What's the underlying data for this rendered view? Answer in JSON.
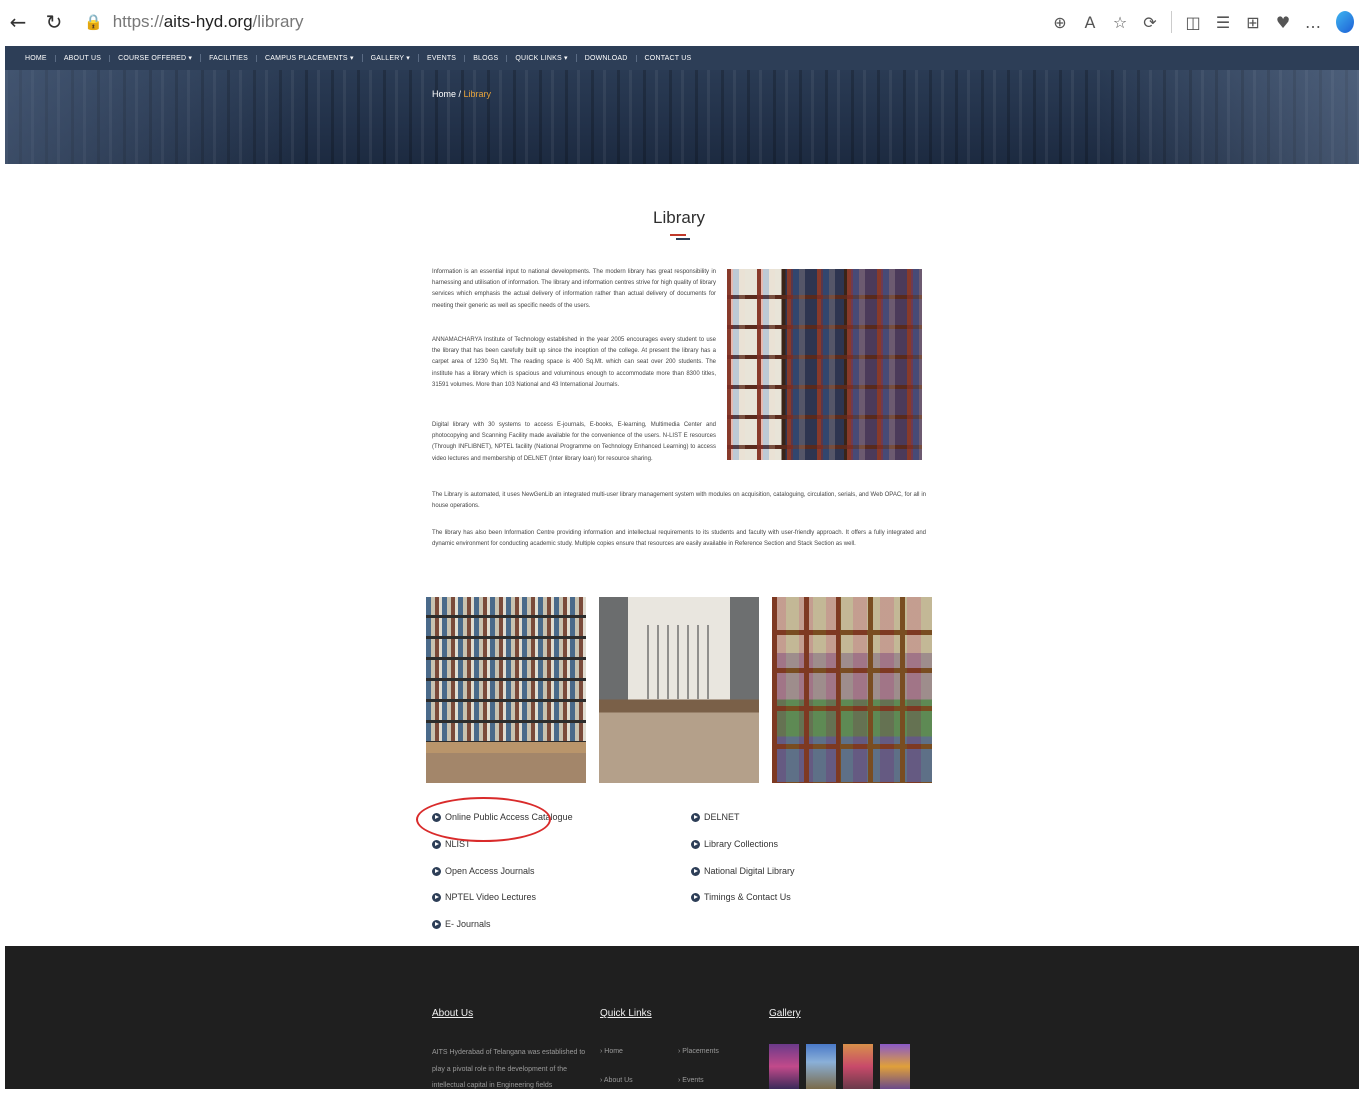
{
  "browser": {
    "url_scheme": "https://",
    "url_domain": "aits-hyd.org",
    "url_path": "/library",
    "icons": [
      "back-icon",
      "refresh-icon",
      "lock-icon",
      "zoom-icon",
      "read-aloud-icon",
      "favorite-icon",
      "extensions-icon",
      "split-screen-icon",
      "favorites-icon",
      "collections-icon",
      "health-icon",
      "more-icon",
      "copilot-icon"
    ]
  },
  "nav": {
    "items": [
      "HOME",
      "ABOUT US",
      "COURSE OFFERED ▾",
      "FACILITIES",
      "CAMPUS PLACEMENTS ▾",
      "GALLERY ▾",
      "EVENTS",
      "BLOGS",
      "QUICK LINKS ▾",
      "DOWNLOAD",
      "CONTACT US"
    ]
  },
  "breadcrumb": {
    "home": "Home",
    "sep": " / ",
    "current": "Library"
  },
  "page": {
    "title": "Library",
    "paragraphs": [
      "Information is an essential input to national developments. The modern library has great responsibility in harnessing and utilisation of information. The library and information centres strive for high quality of library services which emphasis the actual delivery of information rather than actual delivery of documents for meeting their generic as well as specific needs of the users.",
      "ANNAMACHARYA Institute of Technology established in the year 2005 encourages every student to use the library that has been carefully built up since the inception of the college. At present the library has a carpet area of 1230 Sq.Mt. The reading space is 400 Sq.Mt. which can seat over 200 students. The institute has a library which is spacious and voluminous enough to accommodate more than 8300 titles, 31591 volumes. More than 103 National and 43 International Journals.",
      "Digital library with 30 systems to access E-journals, E-books, E-learning, Multimedia Center and photocopying and Scanning Facility made available for the convenience of the users. N-LIST E resources (Through INFLIBNET), NPTEL facility (National Programme on Technology Enhanced Learning) to access video lectures and membership of DELNET (Inter library loan) for resource sharing.",
      "The Library is automated, it uses NewGenLib an integrated multi-user library management system with modules on acquisition, cataloguing, circulation, serials, and Web OPAC, for all in house operations.",
      "The library has also been Information Centre providing information and intellectual requirements to its students and faculty with user-friendly approach. It offers a fully integrated and dynamic environment for conducting academic study. Multiple copies ensure that resources are easily available in Reference Section and Stack Section as well."
    ]
  },
  "links": {
    "left": [
      "Online Public Access Catalogue",
      "NLIST",
      "Open Access Journals",
      "NPTEL Video Lectures",
      "E- Journals"
    ],
    "right": [
      "DELNET",
      "Library Collections",
      "National Digital Library",
      "Timings & Contact Us"
    ]
  },
  "footer": {
    "about_heading": "About Us",
    "about_lines": [
      "AITS Hyderabad of Telangana was established to",
      "play a pivotal role in the development of the",
      "intellectual capital in Engineering fields"
    ],
    "quick_heading": "Quick Links",
    "quick_col1": [
      "Home",
      "About Us"
    ],
    "quick_col2": [
      "Placements",
      "Events"
    ],
    "gallery_heading": "Gallery"
  },
  "colors": {
    "nav_bg": "#2d3e57",
    "accent_red": "#c0392b",
    "highlight": "#d92b2b",
    "footer_bg": "#1f1f1f"
  }
}
